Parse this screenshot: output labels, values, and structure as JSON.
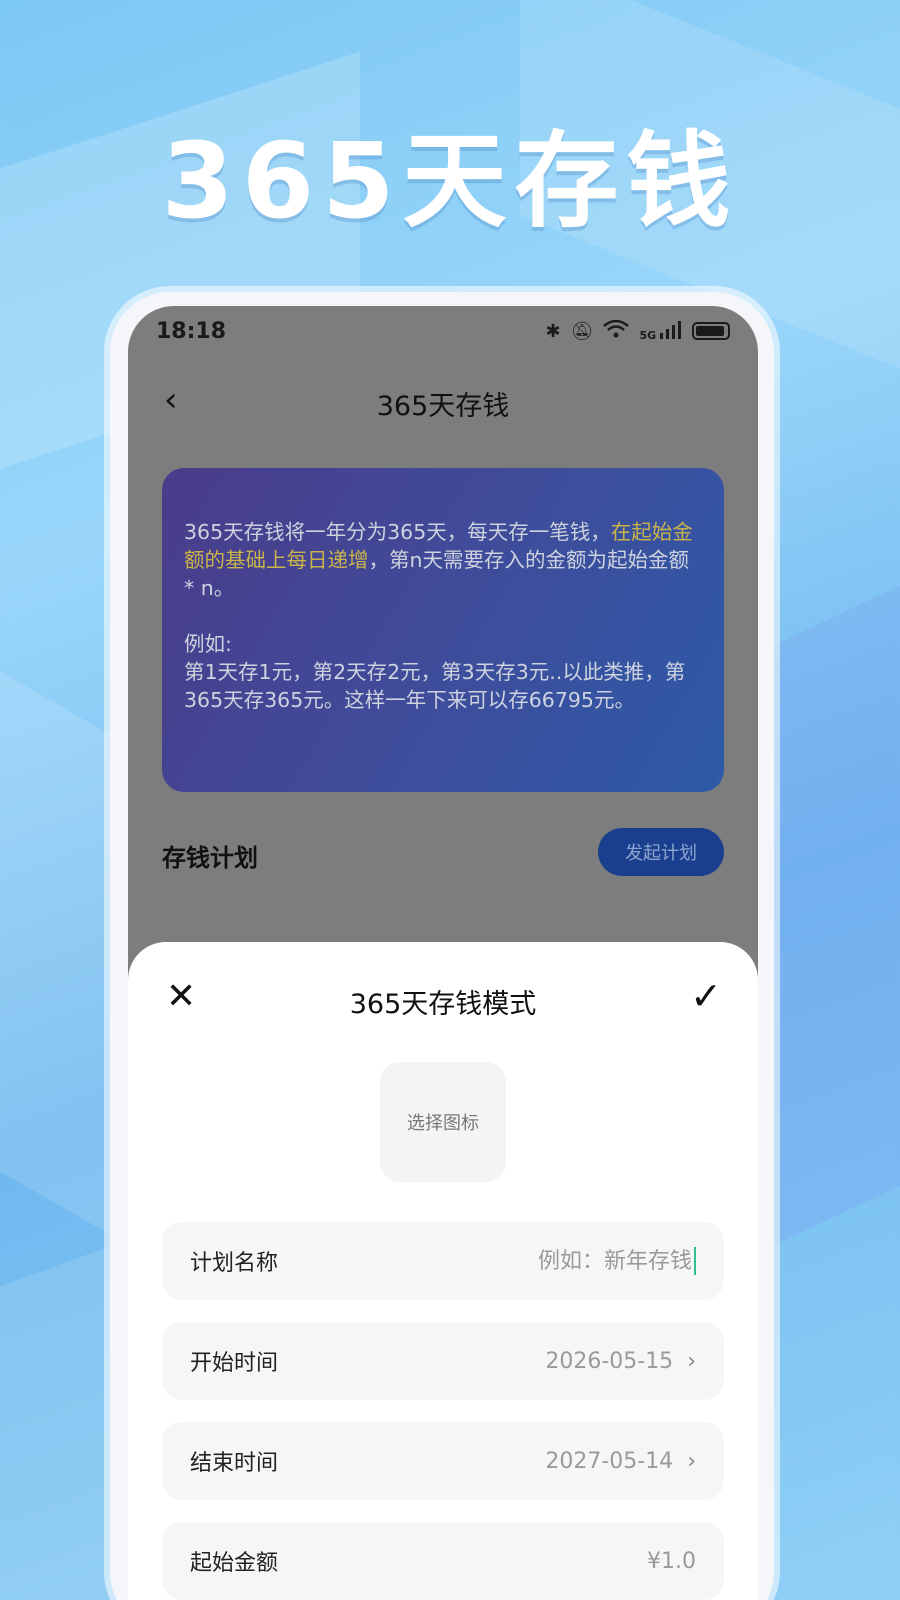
{
  "promo": {
    "title": "365天存钱"
  },
  "status_bar": {
    "time": "18:18",
    "network": "5G"
  },
  "nav": {
    "title": "365天存钱"
  },
  "info_card": {
    "para1_part1": "365天存钱将一年分为365天，每天存一笔钱，",
    "para1_highlight": "在起始金额的基础上每日递增",
    "para1_part2": "，第n天需要存入的金额为起始金额 * n。",
    "para2_line1": "例如:",
    "para2_line2": "第1天存1元，第2天存2元，第3天存3元..以此类推，第365天存365元。这样一年下来可以存66795元。"
  },
  "plan_section": {
    "title": "存钱计划",
    "start_button": "发起计划"
  },
  "sheet": {
    "title": "365天存钱模式",
    "icon_picker_label": "选择图标",
    "rows": [
      {
        "label": "计划名称",
        "placeholder": "例如：新年存钱"
      },
      {
        "label": "开始时间",
        "value": "2026-05-15"
      },
      {
        "label": "结束时间",
        "value": "2027-05-14"
      },
      {
        "label": "起始金额",
        "value": "¥1.0"
      }
    ]
  },
  "colors": {
    "accent_button": "#1a3f8f",
    "highlight_text": "#c9b34a",
    "card_start": "#4a3c8a",
    "card_end": "#2d5aa8"
  }
}
